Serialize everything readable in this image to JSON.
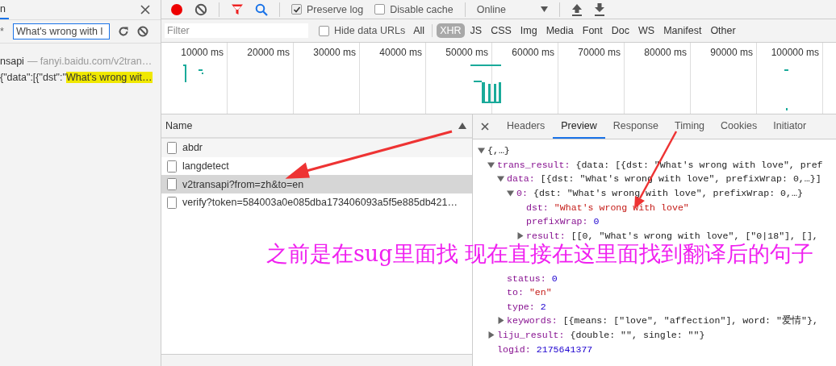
{
  "search_panel": {
    "tab_label": "n",
    "query_prefix": "*",
    "query": "What's wrong with l",
    "results": [
      {
        "name": "nsapi",
        "url": "— fanyi.baidu.com/v2tran…",
        "preview": "{\"data\":[{\"dst\":\"",
        "match": "What's wrong wit…"
      }
    ]
  },
  "toolbar": {
    "recording": true,
    "checkboxes": [
      {
        "label": "Preserve log",
        "checked": true
      },
      {
        "label": "Disable cache",
        "checked": false
      }
    ],
    "throttling": "Online"
  },
  "filter_bar": {
    "placeholder": "Filter",
    "hide_data_urls": {
      "label": "Hide data URLs",
      "checked": false
    },
    "types": [
      {
        "label": "All",
        "selected": false
      },
      {
        "label": "XHR",
        "selected": true
      },
      {
        "label": "JS",
        "selected": false
      },
      {
        "label": "CSS",
        "selected": false
      },
      {
        "label": "Img",
        "selected": false
      },
      {
        "label": "Media",
        "selected": false
      },
      {
        "label": "Font",
        "selected": false
      },
      {
        "label": "Doc",
        "selected": false
      },
      {
        "label": "WS",
        "selected": false
      },
      {
        "label": "Manifest",
        "selected": false
      },
      {
        "label": "Other",
        "selected": false
      }
    ]
  },
  "overview": {
    "ticks": [
      "10000 ms",
      "20000 ms",
      "30000 ms",
      "40000 ms",
      "50000 ms",
      "60000 ms",
      "70000 ms",
      "80000 ms",
      "90000 ms",
      "100000 ms"
    ]
  },
  "requests": {
    "column": "Name",
    "rows": [
      {
        "name": "abdr",
        "selected": false
      },
      {
        "name": "langdetect",
        "selected": false
      },
      {
        "name": "v2transapi?from=zh&to=en",
        "selected": true
      },
      {
        "name": "verify?token=584003a0e085dba173406093a5f5e885db421…",
        "selected": false
      }
    ]
  },
  "preview": {
    "tabs": [
      {
        "label": "Headers",
        "selected": false
      },
      {
        "label": "Preview",
        "selected": true
      },
      {
        "label": "Response",
        "selected": false
      },
      {
        "label": "Timing",
        "selected": false
      },
      {
        "label": "Cookies",
        "selected": false
      },
      {
        "label": "Initiator",
        "selected": false
      }
    ],
    "tree": [
      {
        "kind": "object",
        "expanded": true,
        "value": "{,…}",
        "children": [
          {
            "kind": "object",
            "expanded": true,
            "key": "trans_result:",
            "value": "{data: [{dst: \"What's wrong with love\", pref",
            "children": [
              {
                "kind": "object",
                "expanded": true,
                "key": "data:",
                "value": "[{dst: \"What's wrong with love\", prefixWrap: 0,…}]",
                "children": [
                  {
                    "kind": "object",
                    "expanded": true,
                    "key": "0:",
                    "value": "{dst: \"What's wrong with love\", prefixWrap: 0,…}",
                    "children": [
                      {
                        "kind": "string",
                        "key": "dst:",
                        "value": "\"What's wrong with love\""
                      },
                      {
                        "kind": "number",
                        "key": "prefixWrap:",
                        "value": "0"
                      },
                      {
                        "kind": "object",
                        "expanded": false,
                        "key": "result:",
                        "value": "[[0, \"What's wrong with love\", [\"0|18\"], [],"
                      }
                    ]
                  }
                ]
              },
              {
                "kind": "number",
                "key": "status:",
                "value": "0"
              },
              {
                "kind": "string",
                "key": "to:",
                "value": "\"en\""
              },
              {
                "kind": "number",
                "key": "type:",
                "value": "2"
              },
              {
                "kind": "object",
                "expanded": false,
                "key": "keywords:",
                "value": "[{means: [\"love\", \"affection\"], word: \"爱情\"},"
              }
            ]
          },
          {
            "kind": "object",
            "expanded": false,
            "key": "liju_result:",
            "value": "{double: \"\", single: \"\"}"
          },
          {
            "kind": "number",
            "key": "logid:",
            "value": "2175641377"
          }
        ]
      }
    ]
  },
  "annotation": {
    "text": "之前是在sug里面找 现在直接在这里面找到翻译后的句子"
  }
}
